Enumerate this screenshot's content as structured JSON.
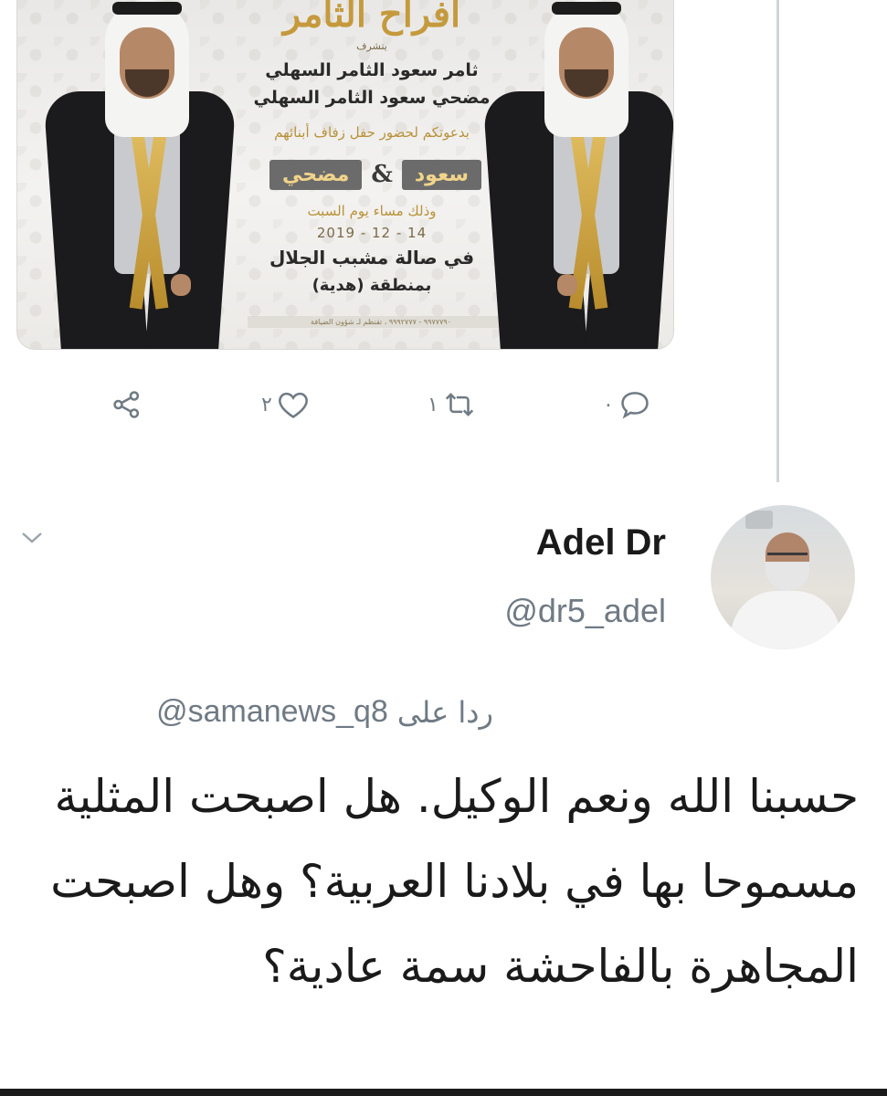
{
  "invitation": {
    "title": "أفراح الثامر",
    "honored": "يتشرف",
    "host1": "ثامر سعود الثامر السهلي",
    "host2": "مضحي سعود الثامر السهلي",
    "invite_line": "بدعوتكم لحضور حفل زفاف أبنائهم",
    "groom1": "سعود",
    "ampersand": "&",
    "groom2": "مضحي",
    "evening": "وذلك مساء يوم السبت",
    "date": "2019 - 12 - 14",
    "hall": "في صالة مشبب الجلال",
    "area": "بمنطقة (هدية)",
    "footer": "٩٩٧٧٧٩٠ - ٩٩٩٢٧٧٧ ، تقنظم لـ شؤون الضيافة"
  },
  "actions": {
    "share_count": "",
    "like_count": "٢",
    "retweet_count": "١",
    "reply_count": "٠"
  },
  "reply": {
    "display_name": "Adel Dr",
    "handle": "@dr5_adel",
    "replying_label": "ردا على",
    "replying_to": "@samanews_q8",
    "text": "حسبنا الله ونعم الوكيل.  هل اصبحت المثلية مسموحا بها في بلادنا العربية؟ وهل اصبحت المجاهرة بالفاحشة سمة عادية؟"
  },
  "colors": {
    "icon_gray": "#6f7a84",
    "gold": "#c59a3c",
    "thread_line": "#cfd6dc"
  }
}
